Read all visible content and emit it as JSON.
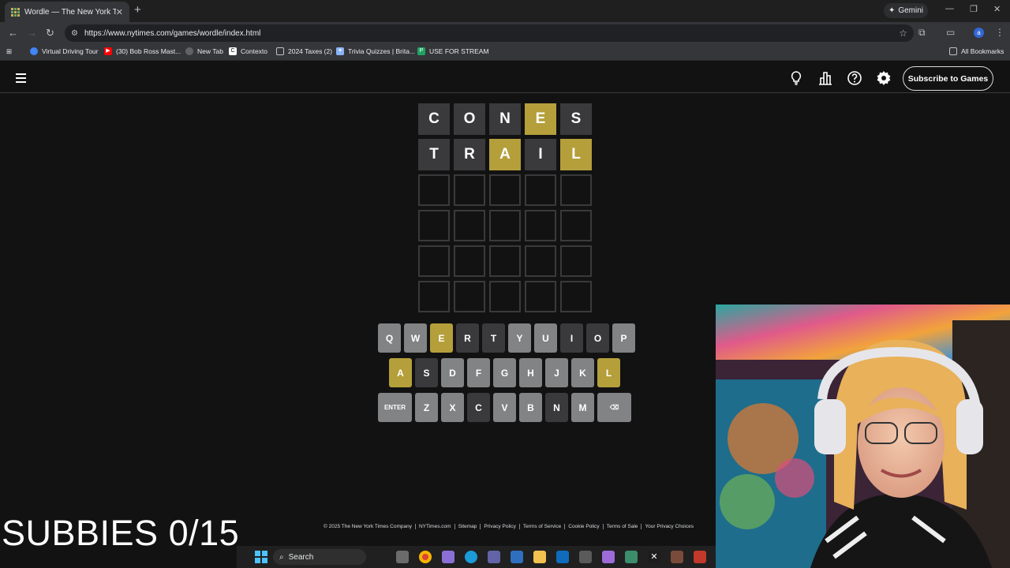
{
  "browser": {
    "tab_title": "Wordle — The New York Times",
    "tab_close": "✕",
    "new_tab": "+",
    "gemini_label": "Gemini",
    "url": "https://www.nytimes.com/games/wordle/index.html",
    "bookmarks": [
      {
        "label": "Virtual Driving Tour",
        "color": "#4285f4"
      },
      {
        "label": "(30) Bob Ross Mast...",
        "color": "#ff0000"
      },
      {
        "label": "New Tab",
        "color": "#5f6368"
      },
      {
        "label": "Contexto",
        "color": "#ffffff"
      },
      {
        "label": "2024 Taxes (2)",
        "color": "#bdc1c6"
      },
      {
        "label": "Trivia Quizzes | Brita...",
        "color": "#8ab4f8"
      },
      {
        "label": "USE FOR STREAM",
        "color": "#1ea362"
      }
    ],
    "all_bookmarks": "All Bookmarks"
  },
  "wordle": {
    "subscribe_label": "Subscribe to Games",
    "board": [
      [
        {
          "l": "C",
          "s": "absent"
        },
        {
          "l": "O",
          "s": "absent"
        },
        {
          "l": "N",
          "s": "absent"
        },
        {
          "l": "E",
          "s": "present"
        },
        {
          "l": "S",
          "s": "absent"
        }
      ],
      [
        {
          "l": "T",
          "s": "absent"
        },
        {
          "l": "R",
          "s": "absent"
        },
        {
          "l": "A",
          "s": "present"
        },
        {
          "l": "I",
          "s": "absent"
        },
        {
          "l": "L",
          "s": "present"
        }
      ],
      [
        {
          "l": "",
          "s": "empty"
        },
        {
          "l": "",
          "s": "empty"
        },
        {
          "l": "",
          "s": "empty"
        },
        {
          "l": "",
          "s": "empty"
        },
        {
          "l": "",
          "s": "empty"
        }
      ],
      [
        {
          "l": "",
          "s": "empty"
        },
        {
          "l": "",
          "s": "empty"
        },
        {
          "l": "",
          "s": "empty"
        },
        {
          "l": "",
          "s": "empty"
        },
        {
          "l": "",
          "s": "empty"
        }
      ],
      [
        {
          "l": "",
          "s": "empty"
        },
        {
          "l": "",
          "s": "empty"
        },
        {
          "l": "",
          "s": "empty"
        },
        {
          "l": "",
          "s": "empty"
        },
        {
          "l": "",
          "s": "empty"
        }
      ],
      [
        {
          "l": "",
          "s": "empty"
        },
        {
          "l": "",
          "s": "empty"
        },
        {
          "l": "",
          "s": "empty"
        },
        {
          "l": "",
          "s": "empty"
        },
        {
          "l": "",
          "s": "empty"
        }
      ]
    ],
    "keyboard": [
      [
        {
          "k": "Q",
          "s": "unused"
        },
        {
          "k": "W",
          "s": "unused"
        },
        {
          "k": "E",
          "s": "present"
        },
        {
          "k": "R",
          "s": "absent"
        },
        {
          "k": "T",
          "s": "absent"
        },
        {
          "k": "Y",
          "s": "unused"
        },
        {
          "k": "U",
          "s": "unused"
        },
        {
          "k": "I",
          "s": "absent"
        },
        {
          "k": "O",
          "s": "absent"
        },
        {
          "k": "P",
          "s": "unused"
        }
      ],
      [
        {
          "k": "A",
          "s": "present"
        },
        {
          "k": "S",
          "s": "absent"
        },
        {
          "k": "D",
          "s": "unused"
        },
        {
          "k": "F",
          "s": "unused"
        },
        {
          "k": "G",
          "s": "unused"
        },
        {
          "k": "H",
          "s": "unused"
        },
        {
          "k": "J",
          "s": "unused"
        },
        {
          "k": "K",
          "s": "unused"
        },
        {
          "k": "L",
          "s": "present"
        }
      ],
      [
        {
          "k": "ENTER",
          "s": "unused"
        },
        {
          "k": "Z",
          "s": "unused"
        },
        {
          "k": "X",
          "s": "unused"
        },
        {
          "k": "C",
          "s": "absent"
        },
        {
          "k": "V",
          "s": "unused"
        },
        {
          "k": "B",
          "s": "unused"
        },
        {
          "k": "N",
          "s": "absent"
        },
        {
          "k": "M",
          "s": "unused"
        },
        {
          "k": "⌫",
          "s": "unused"
        }
      ]
    ],
    "footer_links": [
      "© 2025 The New York Times Company",
      "NYTimes.com",
      "Sitemap",
      "Privacy Policy",
      "Terms of Service",
      "Cookie Policy",
      "Terms of Sale",
      "Your Privacy Choices"
    ]
  },
  "overlay": {
    "subbies_text": "SUBBIES 0/15"
  },
  "taskbar": {
    "search_label": "Search"
  },
  "colors": {
    "present": "#b59f3b",
    "absent": "#3a3a3c",
    "unused": "#818384"
  }
}
